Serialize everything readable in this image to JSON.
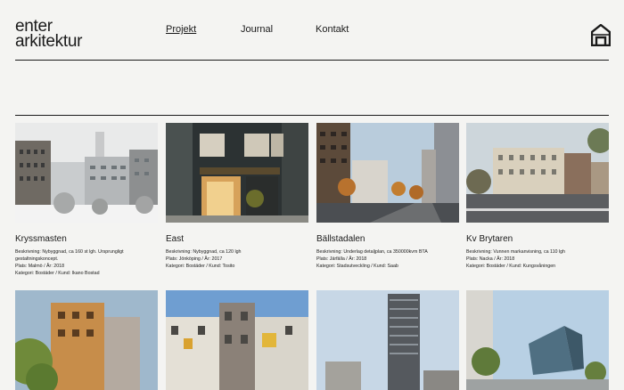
{
  "logo": {
    "line1": "enter",
    "line2": "arkitektur"
  },
  "nav": {
    "items": [
      {
        "label": "Projekt",
        "active": true
      },
      {
        "label": "Journal",
        "active": false
      },
      {
        "label": "Kontakt",
        "active": false
      }
    ]
  },
  "home_icon": "house-logo-icon",
  "projects": [
    {
      "title": "Kryssmasten",
      "beskrivning": "Beskrivning: Nybyggnad, ca 160 st lgh. Ursprungligt",
      "beskrivning2": "gestaltningskoncept.",
      "plats": "Plats: Malmö / År: 2018",
      "kategori": "Kategori: Bostäder / Kund: Ikano Bostad"
    },
    {
      "title": "East",
      "beskrivning": "Beskrivning: Nybyggnad, ca 120 lgh",
      "beskrivning2": "",
      "plats": "Plats: Jönköping / År: 2017",
      "kategori": "Kategori: Bostäder / Kund: Tosito"
    },
    {
      "title": "Bällstadalen",
      "beskrivning": "Beskrivning: Underlag detaljplan, ca 350000kvm BTA",
      "beskrivning2": "",
      "plats": "Plats: Järfälla / År: 2018",
      "kategori": "Kategori: Stadsutveckling / Kund: Saab"
    },
    {
      "title": "Kv Brytaren",
      "beskrivning": "Beskrivning: Vunnen markanvisning, ca 110 lgh",
      "beskrivning2": "",
      "plats": "Plats: Nacka / År: 2018",
      "kategori": "Kategori: Bostäder / Kund: Kungsvåningen"
    }
  ]
}
